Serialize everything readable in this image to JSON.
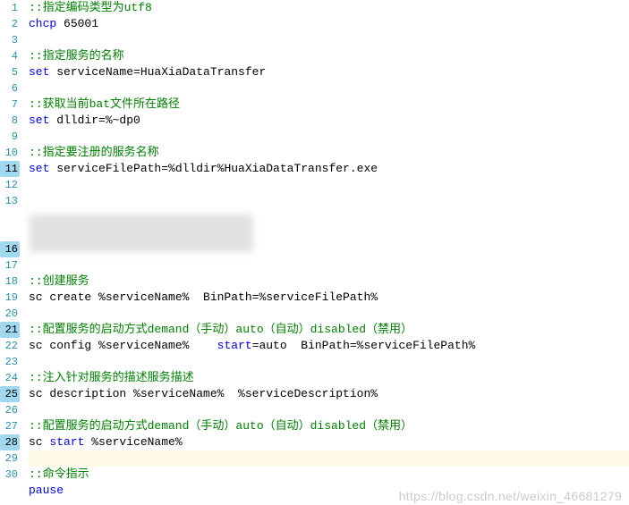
{
  "lineNumbers": [
    "1",
    "2",
    "3",
    "4",
    "5",
    "6",
    "7",
    "8",
    "9",
    "10",
    "11",
    "12",
    "13",
    "",
    "",
    "16",
    "17",
    "18",
    "19",
    "20",
    "21",
    "22",
    "23",
    "24",
    "25",
    "26",
    "27",
    "28",
    "29",
    "30"
  ],
  "highlightedLineNumbers": [
    11,
    16,
    21,
    25,
    28
  ],
  "highlightedRow": 28,
  "lines": {
    "l1": "::指定编码类型为utf8",
    "l2a": "chcp",
    "l2b": " 65001",
    "l4": "::指定服务的名称",
    "l5a": "set",
    "l5b": " serviceName=HuaXiaDataTransfer",
    "l7": "::获取当前bat文件所在路径",
    "l8a": "set",
    "l8b": " dlldir=%~dp0",
    "l10": "::指定要注册的服务名称",
    "l11a": "set",
    "l11b": " serviceFilePath=%dlldir%HuaXiaDataTransfer.exe",
    "l17": "::创建服务",
    "l18": "sc create %serviceName%  BinPath=%serviceFilePath%",
    "l20": "::配置服务的启动方式demand（手动）auto（自动）disabled（禁用）",
    "l21a": "sc config %serviceName%    ",
    "l21b": "start",
    "l21c": "=auto  BinPath=%serviceFilePath%",
    "l23": "::注入针对服务的描述服务描述",
    "l24": "sc description %serviceName%  %serviceDescription%",
    "l26": "::配置服务的启动方式demand（手动）auto（自动）disabled（禁用）",
    "l27a": "sc ",
    "l27b": "start",
    "l27c": " %serviceName%",
    "l29": "::命令指示",
    "l30": "pause"
  },
  "watermark": "https://blog.csdn.net/weixin_46681279"
}
